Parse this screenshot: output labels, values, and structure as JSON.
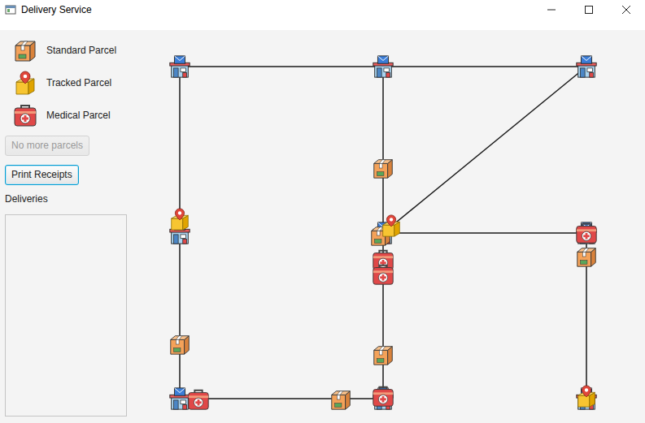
{
  "window": {
    "title": "Delivery Service"
  },
  "legend": [
    {
      "label": "Standard Parcel",
      "kind": "standard"
    },
    {
      "label": "Tracked Parcel",
      "kind": "tracked"
    },
    {
      "label": "Medical Parcel",
      "kind": "medical"
    }
  ],
  "buttons": [
    {
      "label": "No more parcels",
      "disabled": true,
      "focused": false
    },
    {
      "label": "Print Receipts",
      "disabled": false,
      "focused": true
    }
  ],
  "deliveries": {
    "label": "Deliveries",
    "items": []
  },
  "graph": {
    "offices": [
      {
        "kind": "post-office"
      },
      {
        "kind": "post-office"
      },
      {
        "kind": "post-office"
      },
      {
        "kind": "post-office"
      },
      {
        "kind": "post-office"
      },
      {
        "kind": "post-office"
      },
      {
        "kind": "post-office"
      },
      {
        "kind": "post-office"
      },
      {
        "kind": "post-office"
      }
    ],
    "roads": [
      [
        0,
        1
      ],
      [
        1,
        2
      ],
      [
        0,
        3
      ],
      [
        1,
        4
      ],
      [
        2,
        4
      ],
      [
        4,
        5
      ],
      [
        3,
        6
      ],
      [
        4,
        7
      ],
      [
        6,
        7
      ],
      [
        5,
        8
      ]
    ],
    "parcels": [
      {
        "kind": "tracked"
      },
      {
        "kind": "standard"
      },
      {
        "kind": "standard"
      },
      {
        "kind": "tracked"
      },
      {
        "kind": "medical"
      },
      {
        "kind": "medical"
      },
      {
        "kind": "standard"
      },
      {
        "kind": "standard"
      },
      {
        "kind": "medical"
      },
      {
        "kind": "standard"
      },
      {
        "kind": "medical"
      },
      {
        "kind": "standard"
      },
      {
        "kind": "tracked"
      },
      {
        "kind": "medical"
      }
    ]
  }
}
